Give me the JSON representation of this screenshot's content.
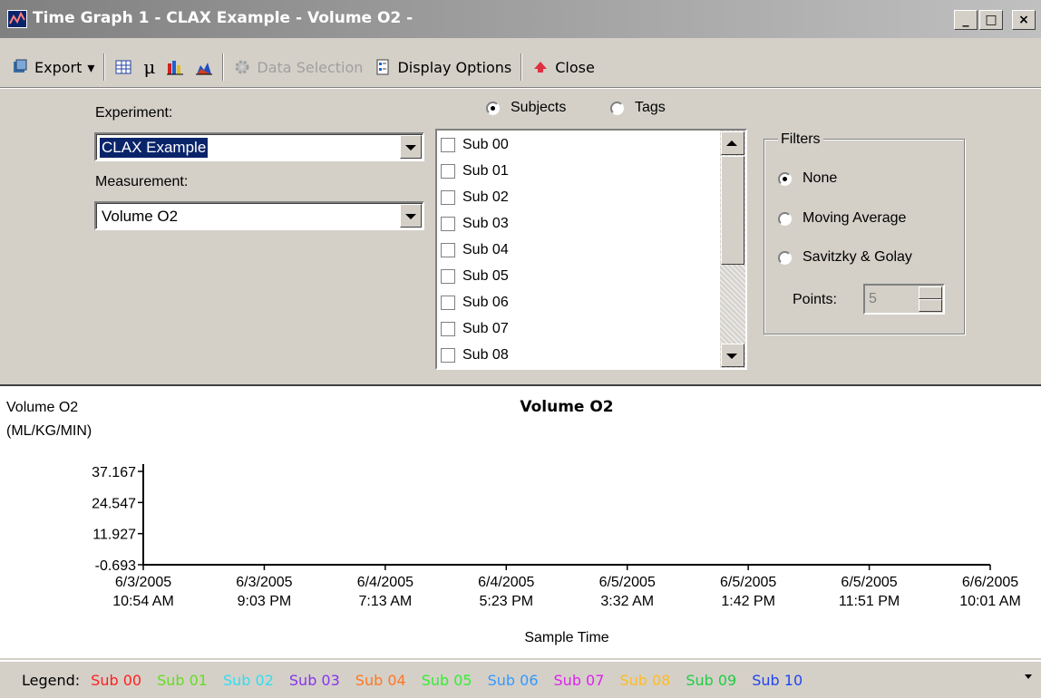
{
  "window": {
    "title": "Time Graph 1 - CLAX Example - Volume O2 -",
    "minimize": "_",
    "maximize": "□",
    "close": "×"
  },
  "toolbar": {
    "export_label": "Export",
    "export_arrow": "▾",
    "mu_label": "μ",
    "data_selection_label": "Data Selection",
    "display_options_label": "Display Options",
    "close_label": "Close"
  },
  "controls": {
    "experiment_label": "Experiment:",
    "experiment_value": "CLAX Example",
    "measurement_label": "Measurement:",
    "measurement_value": "Volume O2",
    "subjects_label": "Subjects",
    "tags_label": "Tags",
    "subjects_selected": true,
    "subjects": [
      "Sub 00",
      "Sub 01",
      "Sub 02",
      "Sub 03",
      "Sub 04",
      "Sub 05",
      "Sub 06",
      "Sub 07",
      "Sub 08"
    ],
    "filters": {
      "title": "Filters",
      "options": [
        "None",
        "Moving Average",
        "Savitzky & Golay"
      ],
      "selected": "None",
      "points_label": "Points:",
      "points_value": "5"
    }
  },
  "chart_data": {
    "type": "line",
    "title": "Volume O2",
    "ylabel_line1": "Volume O2",
    "ylabel_line2": "(ML/KG/MIN)",
    "xlabel": "Sample Time",
    "y_ticks": [
      "37.167",
      "24.547",
      "11.927",
      "-0.693"
    ],
    "ylim": [
      -0.693,
      37.167
    ],
    "x_ticks": [
      {
        "date": "6/3/2005",
        "time": "10:54 AM"
      },
      {
        "date": "6/3/2005",
        "time": "9:03 PM"
      },
      {
        "date": "6/4/2005",
        "time": "7:13 AM"
      },
      {
        "date": "6/4/2005",
        "time": "5:23 PM"
      },
      {
        "date": "6/5/2005",
        "time": "3:32 AM"
      },
      {
        "date": "6/5/2005",
        "time": "1:42 PM"
      },
      {
        "date": "6/5/2005",
        "time": "11:51 PM"
      },
      {
        "date": "6/6/2005",
        "time": "10:01 AM"
      }
    ],
    "series": [],
    "grid": false
  },
  "legend": {
    "label": "Legend:",
    "items": [
      {
        "name": "Sub 00",
        "color": "#ff2020"
      },
      {
        "name": "Sub 01",
        "color": "#66dd22"
      },
      {
        "name": "Sub 02",
        "color": "#33ddee"
      },
      {
        "name": "Sub 03",
        "color": "#8833ee"
      },
      {
        "name": "Sub 04",
        "color": "#ff7722"
      },
      {
        "name": "Sub 05",
        "color": "#33ee33"
      },
      {
        "name": "Sub 06",
        "color": "#3399ff"
      },
      {
        "name": "Sub 07",
        "color": "#dd22ee"
      },
      {
        "name": "Sub 08",
        "color": "#ffbb22"
      },
      {
        "name": "Sub 09",
        "color": "#22cc44"
      },
      {
        "name": "Sub 10",
        "color": "#2244ee"
      }
    ]
  }
}
